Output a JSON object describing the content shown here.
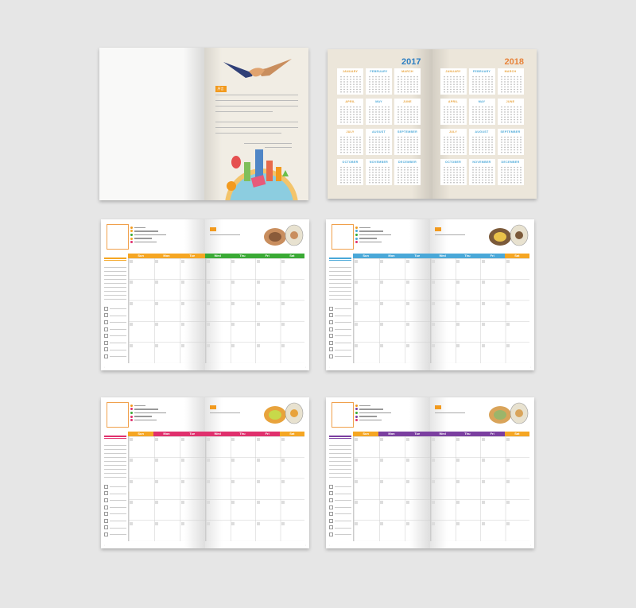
{
  "weekdays": [
    "Sun",
    "Mon",
    "Tue",
    "Wed",
    "Thu",
    "Fri",
    "Sat"
  ],
  "month_label": "Month",
  "intro_tag": "序言",
  "years": [
    "2017",
    "2018"
  ],
  "months": [
    "JANUARY",
    "FEBRUARY",
    "MARCH",
    "APRIL",
    "MAY",
    "JUNE",
    "JULY",
    "AUGUST",
    "SEPTEMBER",
    "OCTOBER",
    "NOVEMBER",
    "DECEMBER"
  ],
  "month_colors": [
    "#e8a33c",
    "#4aa8d8",
    "#e8a33c",
    "#e8a33c",
    "#4aa8d8",
    "#e8a33c",
    "#e8a33c",
    "#4aa8d8",
    "#4aa8d8",
    "#4aa8d8",
    "#4aa8d8",
    "#4aa8d8"
  ],
  "year_colors": [
    "#2e7fc2",
    "#e8833a"
  ],
  "planner_themes": [
    {
      "header": [
        "#f5a623",
        "#f5a623",
        "#f5a623",
        "#3aaa35",
        "#3aaa35",
        "#3aaa35",
        "#3aaa35"
      ]
    },
    {
      "header": [
        "#4aa8d8",
        "#4aa8d8",
        "#4aa8d8",
        "#4aa8d8",
        "#4aa8d8",
        "#4aa8d8",
        "#f5a623"
      ]
    },
    {
      "header": [
        "#f5a623",
        "#e0306d",
        "#e0306d",
        "#e0306d",
        "#e0306d",
        "#e0306d",
        "#f5a623"
      ]
    },
    {
      "header": [
        "#f5a623",
        "#7b3fa0",
        "#7b3fa0",
        "#7b3fa0",
        "#7b3fa0",
        "#7b3fa0",
        "#f5a623"
      ]
    }
  ]
}
